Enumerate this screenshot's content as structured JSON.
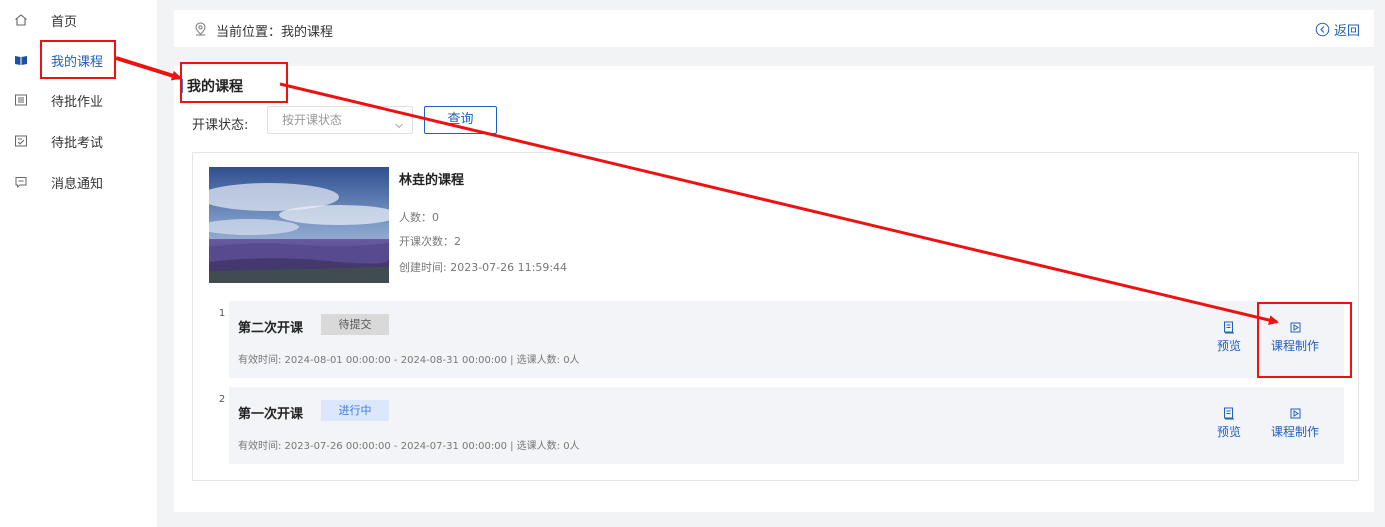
{
  "sidebar": {
    "items": [
      {
        "label": "首页",
        "icon": "home-icon"
      },
      {
        "label": "我的课程",
        "icon": "book-icon",
        "active": true
      },
      {
        "label": "待批作业",
        "icon": "list-icon"
      },
      {
        "label": "待批考试",
        "icon": "exam-icon"
      },
      {
        "label": "消息通知",
        "icon": "message-icon"
      }
    ]
  },
  "breadcrumb": {
    "text": "当前位置：我的课程",
    "back_label": "返回"
  },
  "section_title": "我的课程",
  "filter": {
    "label": "开课状态:",
    "placeholder": "按开课状态",
    "query_label": "查询"
  },
  "course": {
    "title": "林垚的课程",
    "people": "人数：0",
    "sessions_count": "开课次数：2",
    "created": "创建时间: 2023-07-26 11:59:44"
  },
  "sessions": [
    {
      "index": "1",
      "name": "第二次开课",
      "status": "待提交",
      "info": "有效时间: 2024-08-01 00:00:00 - 2024-08-31 00:00:00   |   选课人数: 0人",
      "preview_label": "预览",
      "make_label": "课程制作"
    },
    {
      "index": "2",
      "name": "第一次开课",
      "status": "进行中",
      "info": "有效时间: 2023-07-26 00:00:00 - 2024-07-31 00:00:00   |   选课人数: 0人",
      "preview_label": "预览",
      "make_label": "课程制作"
    }
  ],
  "colors": {
    "accent": "#1f5fbf",
    "annotation": "#e11111"
  }
}
